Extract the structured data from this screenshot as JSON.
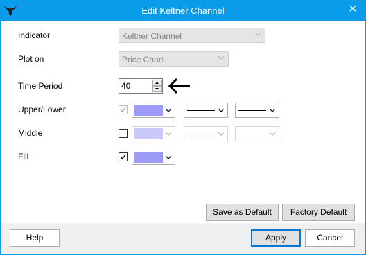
{
  "window": {
    "title": "Edit Keltner Channel",
    "close_glyph": "✕",
    "app_icon": "bull-logo-icon"
  },
  "fields": {
    "indicator": {
      "label": "Indicator",
      "value": "Keltner Channel"
    },
    "plot_on": {
      "label": "Plot on",
      "value": "Price Chart"
    },
    "time_period": {
      "label": "Time Period",
      "value": "40"
    },
    "upper_lower": {
      "label": "Upper/Lower",
      "checked": true,
      "color": "#9c9cf8",
      "line_style": "solid"
    },
    "middle": {
      "label": "Middle",
      "checked": false,
      "color": "#9c9cf8",
      "line_style": "dotted"
    },
    "fill": {
      "label": "Fill",
      "checked": true,
      "color": "#9c9cf8"
    }
  },
  "buttons": {
    "save_default": "Save as Default",
    "factory_default": "Factory Default",
    "help": "Help",
    "apply": "Apply",
    "cancel": "Cancel"
  },
  "annotation": {
    "pointer": "left-arrow-icon"
  },
  "colors": {
    "titlebar": "#0a9bea",
    "accent": "#0078d7"
  }
}
